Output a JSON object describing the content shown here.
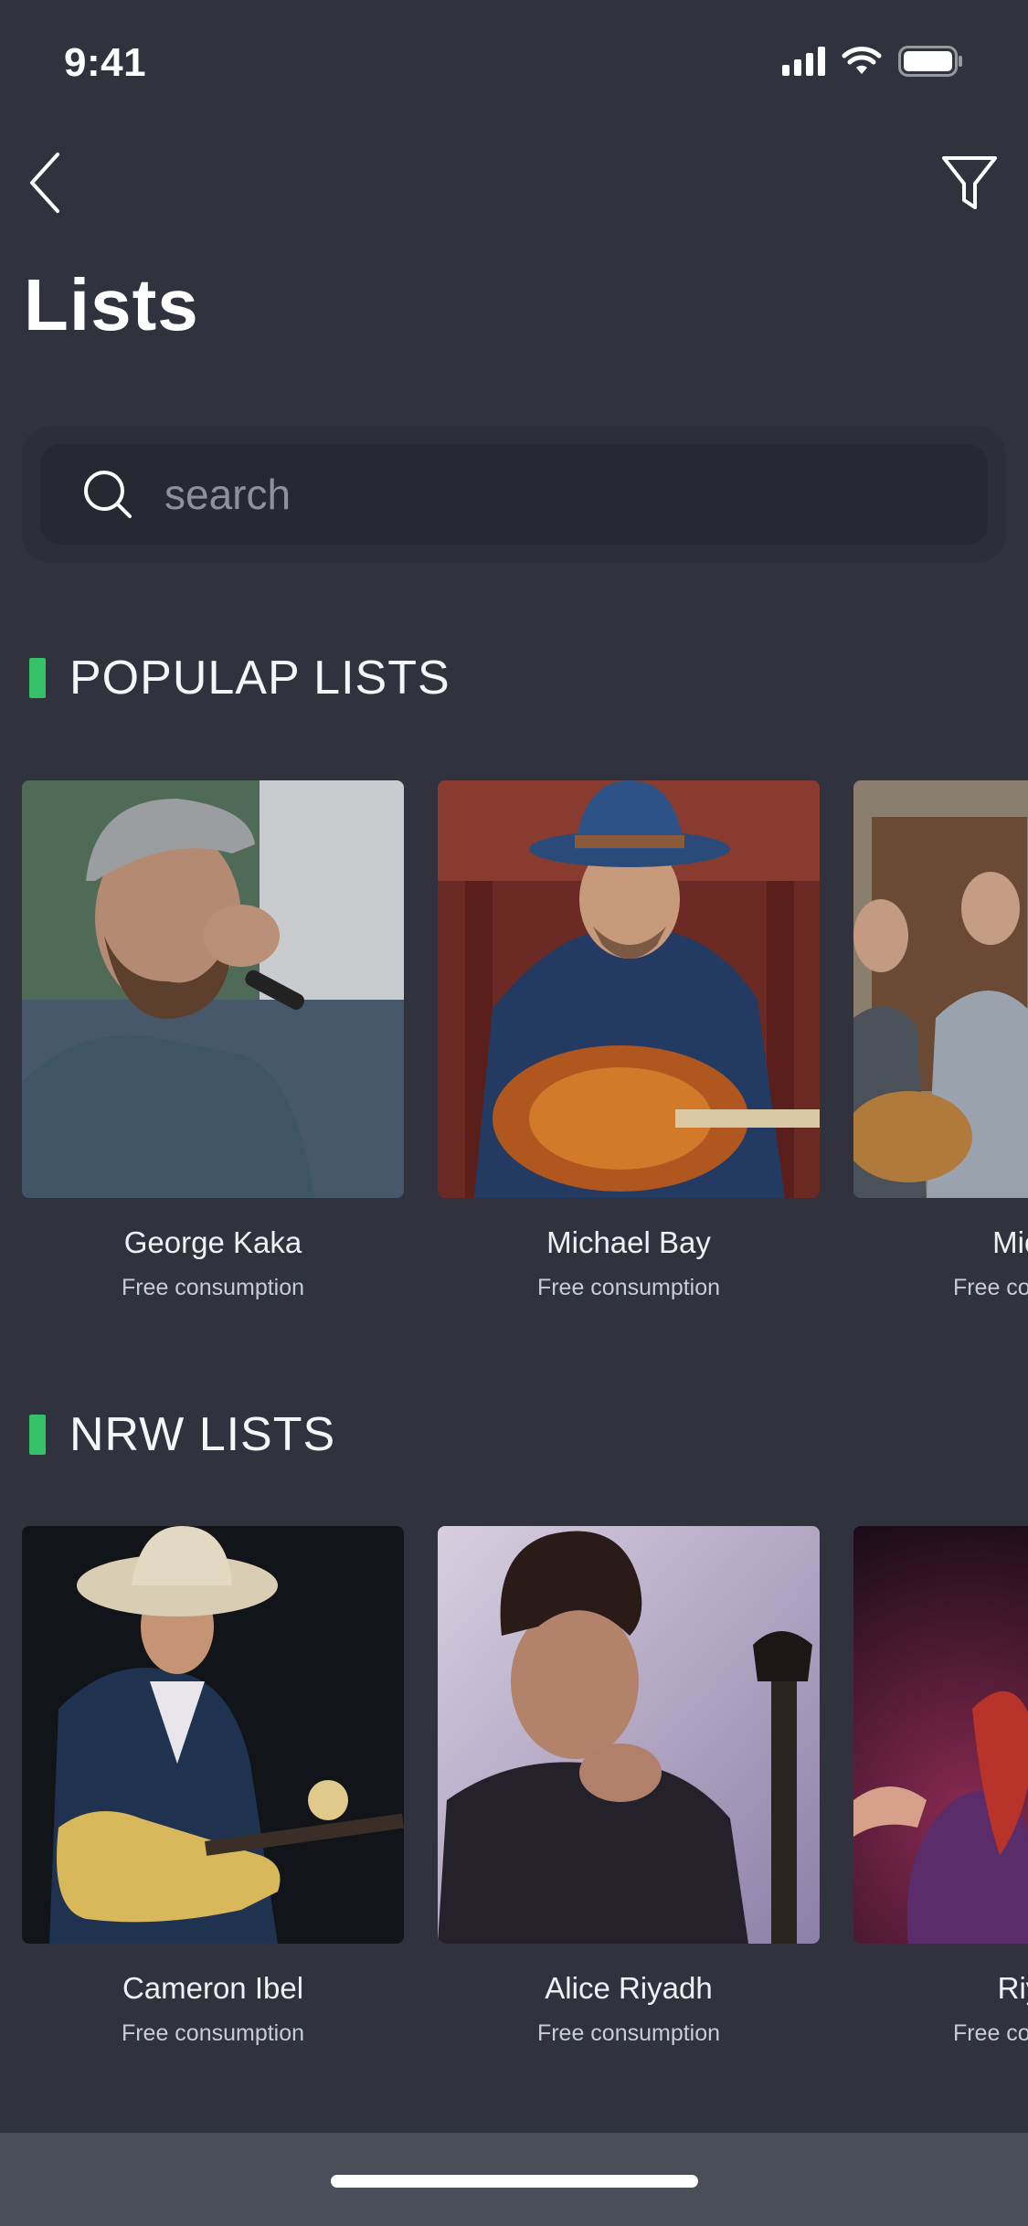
{
  "status": {
    "time": "9:41"
  },
  "header": {
    "title": "Lists"
  },
  "search": {
    "placeholder": "search"
  },
  "sections": [
    {
      "title": "POPULAP LISTS",
      "cards": [
        {
          "name": "George Kaka",
          "subtitle": "Free consumption"
        },
        {
          "name": "Michael Bay",
          "subtitle": "Free consumption"
        },
        {
          "name": "Michael",
          "subtitle": "Free consumption"
        }
      ]
    },
    {
      "title": "NRW LISTS",
      "cards": [
        {
          "name": "Cameron Ibel",
          "subtitle": "Free consumption"
        },
        {
          "name": "Alice Riyadh",
          "subtitle": "Free consumption"
        },
        {
          "name": "Riyadh",
          "subtitle": "Free consumption"
        }
      ]
    }
  ],
  "colors": {
    "background": "#30333d",
    "accent": "#35c168",
    "search_bg": "#262932"
  }
}
